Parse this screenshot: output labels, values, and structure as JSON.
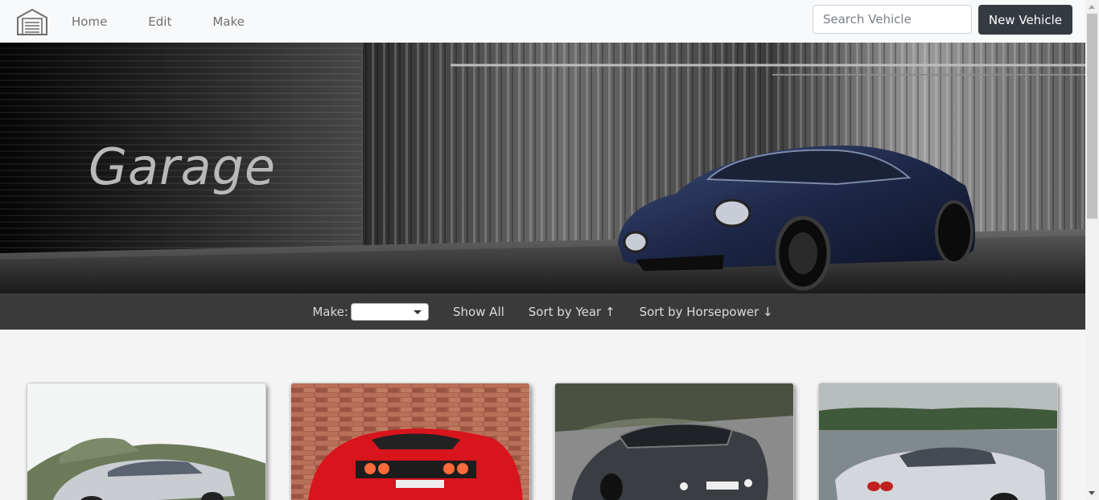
{
  "nav": {
    "brand_icon": "garage-icon",
    "links": [
      {
        "label": "Home"
      },
      {
        "label": "Edit"
      },
      {
        "label": "Make"
      }
    ],
    "search": {
      "placeholder": "Search Vehicle",
      "value": ""
    },
    "new_vehicle_label": "New Vehicle"
  },
  "hero": {
    "title": "Garage"
  },
  "filters": {
    "make_label": "Make:",
    "make_selected": "",
    "show_all": "Show All",
    "sort_year": "Sort by Year ↑",
    "sort_horsepower": "Sort by Horsepower ↓"
  },
  "colors": {
    "navbar_bg": "#f8f9fa",
    "filterbar_bg": "#3a3a3a",
    "button_dark": "#343a40",
    "page_bg": "#f4f4f5"
  },
  "cards": [
    {
      "image": "silver-sedan-photo"
    },
    {
      "image": "red-sports-car-photo"
    },
    {
      "image": "dark-gray-sedan-photo"
    },
    {
      "image": "silver-coupe-photo"
    }
  ]
}
